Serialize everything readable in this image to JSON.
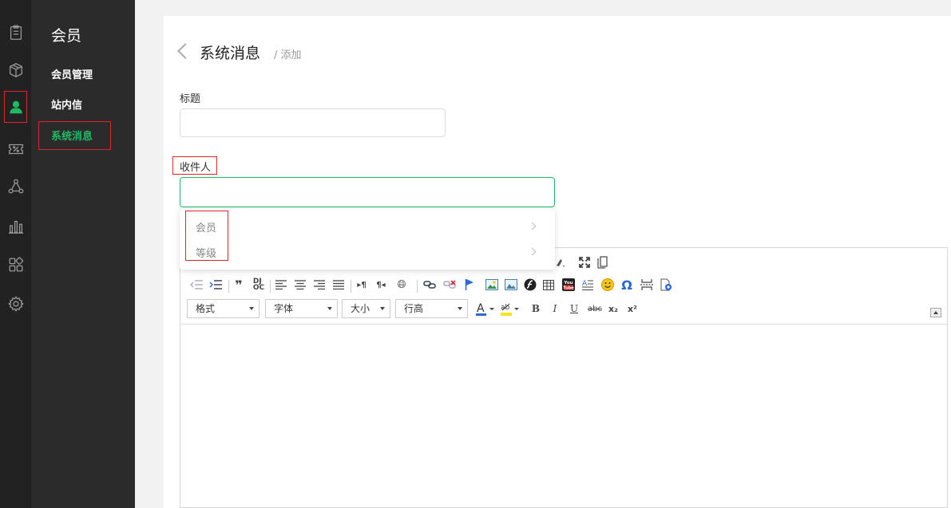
{
  "rail": {
    "icons": [
      "clipboard-icon",
      "box-icon",
      "user-icon",
      "coupon-icon",
      "share-icon",
      "bar-chart-icon",
      "apps-icon",
      "gear-icon"
    ],
    "active": "user-icon",
    "active_color": "#1fba63"
  },
  "sidebar": {
    "title": "会员",
    "items": [
      {
        "label": "会员管理"
      },
      {
        "label": "站内信"
      },
      {
        "label": "系统消息"
      }
    ],
    "active_index": 2,
    "accent": "#1fba63"
  },
  "page": {
    "title": "系统消息",
    "subtitle": "/ 添加"
  },
  "form": {
    "title_label": "标题",
    "title_value": "",
    "recipient_label": "收件人",
    "recipient_value": ""
  },
  "dropdown": {
    "options": [
      {
        "label": "会员"
      },
      {
        "label": "等级"
      }
    ]
  },
  "editor": {
    "selects": {
      "format": "格式",
      "font": "字体",
      "size": "大小",
      "line_height": "行高"
    },
    "buttons": {
      "bold": "B",
      "italic": "I",
      "underline": "U",
      "strike": "abc",
      "subscript": "x₂",
      "superscript": "x²",
      "omega": "Ω",
      "youtube": "You"
    },
    "content": ""
  },
  "colors": {
    "highlight_red": "#e0242a",
    "accent_green": "#1fba63"
  }
}
